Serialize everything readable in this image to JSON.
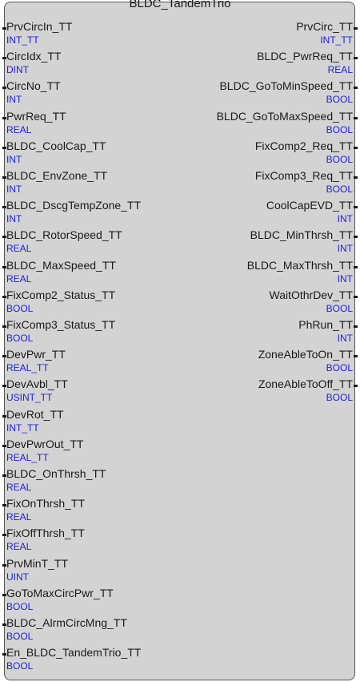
{
  "block": {
    "title": "BLDC_TandemTrio",
    "inputs": [
      {
        "name": "PrvCircIn_TT",
        "type": "INT_TT"
      },
      {
        "name": "CircIdx_TT",
        "type": "DINT"
      },
      {
        "name": "CircNo_TT",
        "type": "INT"
      },
      {
        "name": "PwrReq_TT",
        "type": "REAL"
      },
      {
        "name": "BLDC_CoolCap_TT",
        "type": "INT"
      },
      {
        "name": "BLDC_EnvZone_TT",
        "type": "INT"
      },
      {
        "name": "BLDC_DscgTempZone_TT",
        "type": "INT"
      },
      {
        "name": "BLDC_RotorSpeed_TT",
        "type": "REAL"
      },
      {
        "name": "BLDC_MaxSpeed_TT",
        "type": "REAL"
      },
      {
        "name": "FixComp2_Status_TT",
        "type": "BOOL"
      },
      {
        "name": "FixComp3_Status_TT",
        "type": "BOOL"
      },
      {
        "name": "DevPwr_TT",
        "type": "REAL_TT"
      },
      {
        "name": "DevAvbl_TT",
        "type": "USINT_TT"
      },
      {
        "name": "DevRot_TT",
        "type": "INT_TT"
      },
      {
        "name": "DevPwrOut_TT",
        "type": "REAL_TT"
      },
      {
        "name": "BLDC_OnThrsh_TT",
        "type": "REAL"
      },
      {
        "name": "FixOnThrsh_TT",
        "type": "REAL"
      },
      {
        "name": "FixOffThrsh_TT",
        "type": "REAL"
      },
      {
        "name": "PrvMinT_TT",
        "type": "UINT"
      },
      {
        "name": "GoToMaxCircPwr_TT",
        "type": "BOOL"
      },
      {
        "name": "BLDC_AlrmCircMng_TT",
        "type": "BOOL"
      },
      {
        "name": "En_BLDC_TandemTrio_TT",
        "type": "BOOL"
      }
    ],
    "outputs": [
      {
        "name": "PrvCirc_TT",
        "type": "INT_TT"
      },
      {
        "name": "BLDC_PwrReq_TT",
        "type": "REAL"
      },
      {
        "name": "BLDC_GoToMinSpeed_TT",
        "type": "BOOL"
      },
      {
        "name": "BLDC_GoToMaxSpeed_TT",
        "type": "BOOL"
      },
      {
        "name": "FixComp2_Req_TT",
        "type": "BOOL"
      },
      {
        "name": "FixComp3_Req_TT",
        "type": "BOOL"
      },
      {
        "name": "CoolCapEVD_TT",
        "type": "INT"
      },
      {
        "name": "BLDC_MinThrsh_TT",
        "type": "INT"
      },
      {
        "name": "BLDC_MaxThrsh_TT",
        "type": "INT"
      },
      {
        "name": "WaitOthrDev_TT",
        "type": "BOOL"
      },
      {
        "name": "PhRun_TT",
        "type": "INT"
      },
      {
        "name": "ZoneAbleToOn_TT",
        "type": "BOOL"
      },
      {
        "name": "ZoneAbleToOff_TT",
        "type": "BOOL"
      }
    ]
  },
  "colors": {
    "block_fill": "#d3d3d3",
    "type_text": "#1f1fdc",
    "name_text": "#1a1a1a"
  }
}
